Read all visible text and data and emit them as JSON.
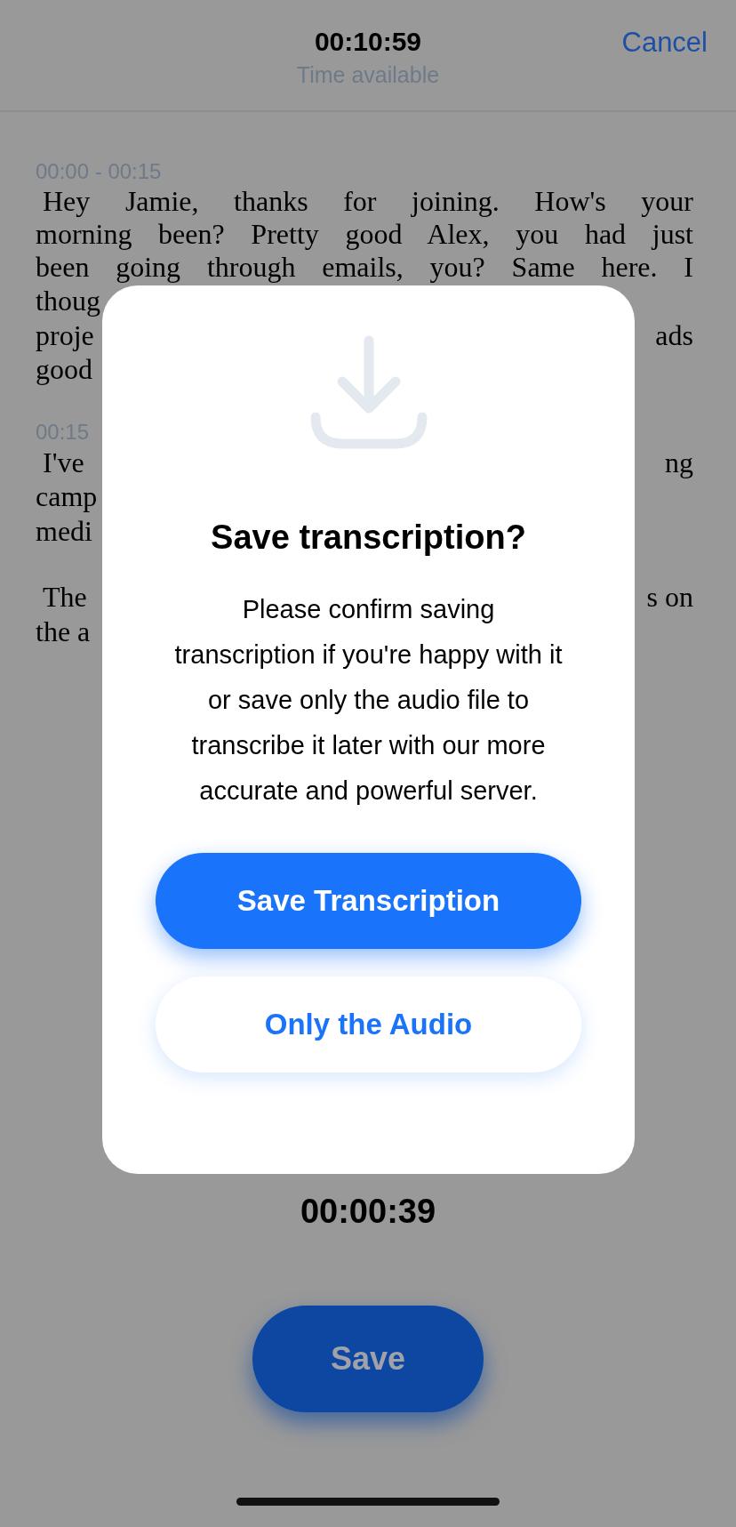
{
  "header": {
    "time": "00:10:59",
    "subtitle": "Time available",
    "cancel": "Cancel"
  },
  "transcript": [
    {
      "timestamp": "00:00 - 00:15",
      "lines": [
        {
          "text": "Hey Jamie, thanks for joining. How's your"
        },
        {
          "text": "morning been? Pretty good Alex, you had just"
        },
        {
          "text": "been going through emails, you? Same here. I"
        },
        {
          "left": "thoug"
        },
        {
          "left": "proje",
          "right": "ads"
        },
        {
          "left": "good"
        }
      ]
    },
    {
      "timestamp": "00:15",
      "lines": [
        {
          "left": "I've",
          "right": "ng"
        },
        {
          "left": "camp"
        },
        {
          "left": "medi"
        }
      ]
    },
    {
      "lines": [
        {
          "left": "The",
          "right": "s on"
        },
        {
          "left": "the a"
        }
      ]
    }
  ],
  "recording": {
    "elapsed": "00:00:39",
    "save": "Save"
  },
  "dialog": {
    "title": "Save transcription?",
    "message": "Please confirm saving transcription if you're happy with it or save only the audio file to transcribe it later with our more accurate and powerful server.",
    "buttons": [
      {
        "label": "Save Transcription",
        "kind": "primary"
      },
      {
        "label": "Only the Audio",
        "kind": "secondary"
      }
    ]
  }
}
